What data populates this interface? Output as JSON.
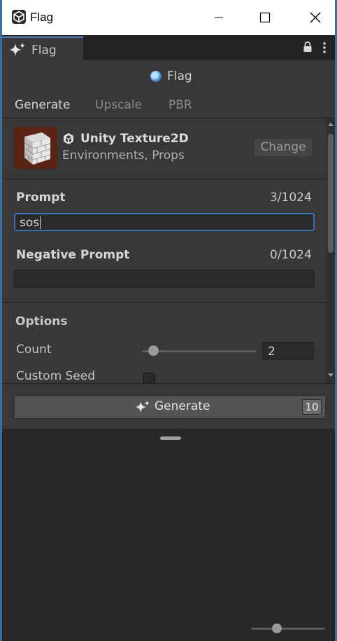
{
  "window": {
    "title": "Flag"
  },
  "tab": {
    "label": "Flag"
  },
  "header": {
    "label": "Flag"
  },
  "tabs": [
    {
      "label": "Generate",
      "active": true
    },
    {
      "label": "Upscale",
      "active": false
    },
    {
      "label": "PBR",
      "active": false
    }
  ],
  "model": {
    "name": "Unity Texture2D",
    "tags": "Environments, Props",
    "change_label": "Change"
  },
  "prompt": {
    "label": "Prompt",
    "counter": "3/1024",
    "value": "sos"
  },
  "negative_prompt": {
    "label": "Negative Prompt",
    "counter": "0/1024",
    "value": ""
  },
  "options": {
    "title": "Options",
    "count_label": "Count",
    "count_value": "2",
    "count_slider_fraction": 0.1,
    "custom_seed_label": "Custom Seed",
    "custom_seed_checked": false
  },
  "generate": {
    "label": "Generate",
    "cost": "10"
  },
  "colors": {
    "accent": "#3d6fb3",
    "panel": "#383838",
    "dark": "#282828"
  },
  "icons": {
    "app": "unity-logo-icon",
    "tab": "sparkle-icon",
    "lock": "lock-icon",
    "menu": "kebab-menu-icon",
    "flag": "flag-status-icon",
    "generate": "sparkle-icon"
  }
}
